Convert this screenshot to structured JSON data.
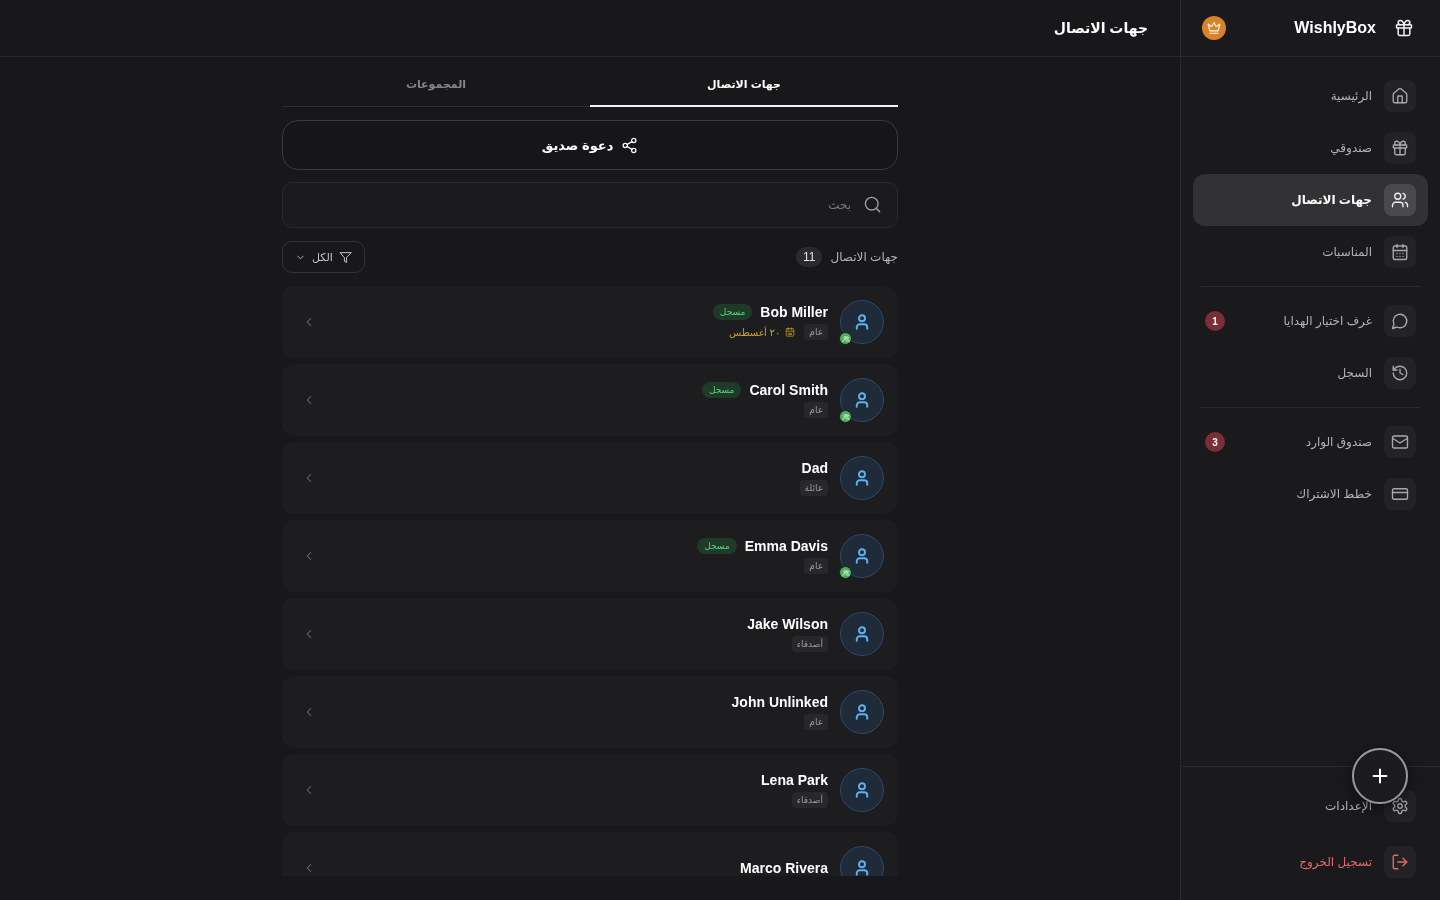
{
  "sidebar": {
    "brand": "WishlyBox",
    "groups": [
      {
        "items": [
          {
            "kind": "home",
            "label": "الرئيسية",
            "selected": false
          },
          {
            "kind": "box",
            "label": "صندوقي",
            "selected": false
          },
          {
            "kind": "contacts",
            "label": "جهات الاتصال",
            "selected": true
          },
          {
            "kind": "events",
            "label": "المناسبات",
            "selected": false
          }
        ]
      },
      {
        "items": [
          {
            "kind": "rooms",
            "label": "غرف اختيار الهدايا",
            "selected": false,
            "badge": "1"
          },
          {
            "kind": "history",
            "label": "السجل",
            "selected": false
          }
        ]
      },
      {
        "items": [
          {
            "kind": "inbox",
            "label": "صندوق الوارد",
            "selected": false,
            "badge": "3"
          },
          {
            "kind": "plans",
            "label": "خطط الاشتراك",
            "selected": false
          }
        ]
      }
    ],
    "footer": [
      {
        "kind": "settings",
        "label": "الإعدادات",
        "selected": false
      },
      {
        "kind": "logout",
        "label": "تسجيل الخروج",
        "selected": false
      }
    ]
  },
  "header": {
    "title": "جهات الاتصال"
  },
  "tabs": [
    {
      "label": "جهات الاتصال",
      "selected": true
    },
    {
      "label": "المجموعات",
      "selected": false
    }
  ],
  "invite_button": {
    "label": "دعوة صديق"
  },
  "search": {
    "placeholder": "بحث"
  },
  "summary": {
    "label": "جهات الاتصال",
    "count": "11"
  },
  "filter": {
    "label": "الكل"
  },
  "contacts": [
    {
      "name": "Bob Miller",
      "registered": true,
      "status_label": "مسجل",
      "tag": "عام",
      "date": "٢٠ أغسطس"
    },
    {
      "name": "Carol Smith",
      "registered": true,
      "status_label": "مسجل",
      "tag": "عام"
    },
    {
      "name": "Dad",
      "registered": false,
      "tag": "عائلة"
    },
    {
      "name": "Emma Davis",
      "registered": true,
      "status_label": "مسجل",
      "tag": "عام"
    },
    {
      "name": "Jake Wilson",
      "registered": false,
      "tag": "أصدقاء"
    },
    {
      "name": "John Unlinked",
      "registered": false,
      "tag": "عام"
    },
    {
      "name": "Lena Park",
      "registered": false,
      "tag": "أصدقاء"
    },
    {
      "name": "Marco Rivera",
      "registered": false
    }
  ]
}
